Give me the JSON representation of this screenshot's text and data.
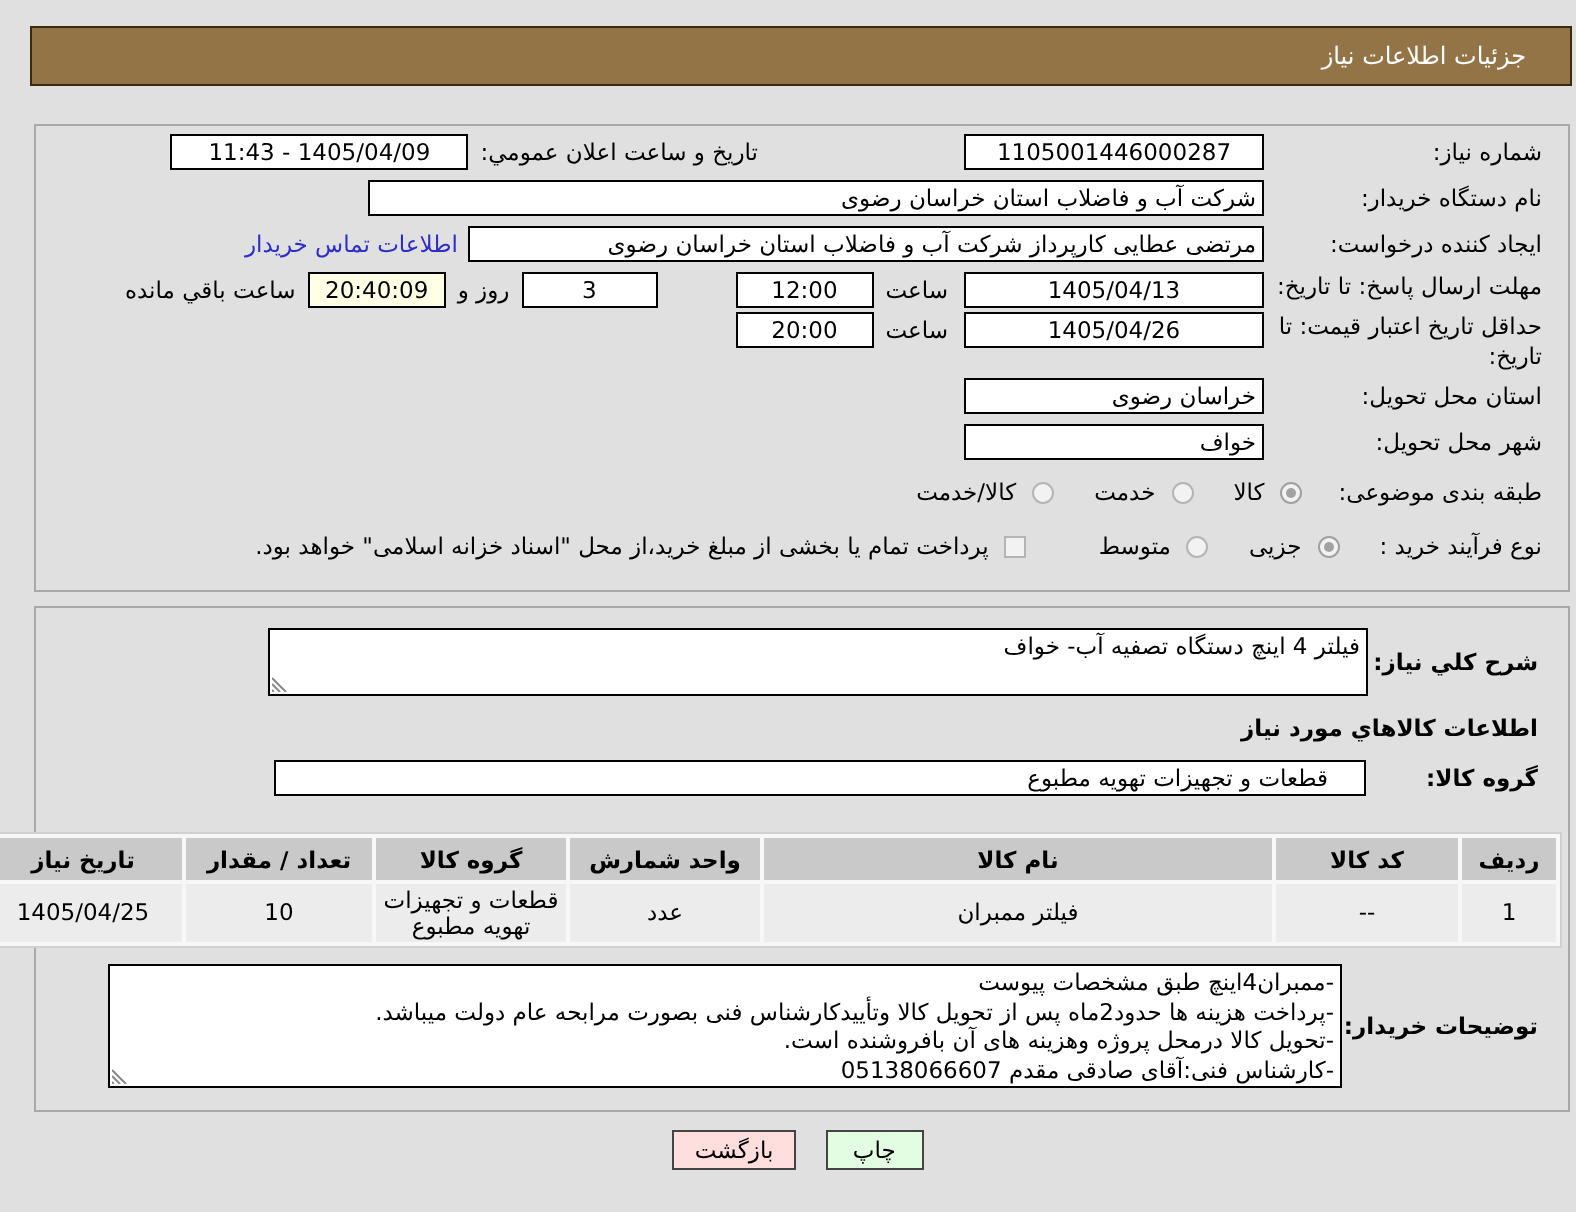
{
  "header": {
    "title": "جزئیات اطلاعات نیاز"
  },
  "details": {
    "need_number": {
      "label": "شماره نیاز:",
      "value": "1105001446000287"
    },
    "announce_datetime": {
      "label": "تاریخ و ساعت اعلان عمومي:",
      "value": "1405/04/09 - 11:43"
    },
    "buyer_org": {
      "label": "نام دستگاه خریدار:",
      "value": "شرکت آب و فاضلاب استان خراسان رضوی"
    },
    "requester": {
      "label": "ایجاد کننده درخواست:",
      "value": "مرتضی عطایی کارپرداز شرکت آب و فاضلاب استان خراسان رضوی",
      "link": "اطلاعات تماس خریدار"
    },
    "response_deadline": {
      "label": "مهلت ارسال پاسخ: تا تاریخ:",
      "date": "1405/04/13",
      "time_label": "ساعت",
      "time": "12:00",
      "days": "3",
      "days_label": "روز و",
      "remaining": "20:40:09",
      "remaining_label": "ساعت باقي مانده"
    },
    "price_validity": {
      "label": "حداقل تاريخ اعتبار قيمت: تا تاریخ:",
      "date": "1405/04/26",
      "time_label": "ساعت",
      "time": "20:00"
    },
    "delivery_province": {
      "label": "استان محل تحویل:",
      "value": "خراسان رضوی"
    },
    "delivery_city": {
      "label": "شهر محل تحویل:",
      "value": "خواف"
    },
    "subject_category": {
      "label": "طبقه بندی موضوعی:",
      "options": [
        {
          "label": "كالا",
          "selected": true
        },
        {
          "label": "خدمت",
          "selected": false
        },
        {
          "label": "كالا/خدمت",
          "selected": false
        }
      ]
    },
    "purchase_process": {
      "label": "نوع فرآیند خرید :",
      "options": [
        {
          "label": "جزیی",
          "selected": true
        },
        {
          "label": "متوسط",
          "selected": false
        }
      ],
      "treasury_option": {
        "label": "پرداخت تمام یا بخشی از مبلغ خرید،از محل \"اسناد خزانه اسلامی\" خواهد بود.",
        "checked": false
      }
    }
  },
  "need": {
    "description_label": "شرح كلي نياز:",
    "description": "فیلتر 4 اینچ دستگاه تصفیه آب- خواف",
    "goods_title": "اطلاعات كالاهاي مورد نياز",
    "goods_group_label": "گروه کالا:",
    "goods_group": "قطعات و تجهیزات تهویه مطبوع",
    "table": {
      "columns": [
        "ردیف",
        "کد کالا",
        "نام کالا",
        "واحد شمارش",
        "گروه کالا",
        "تعداد / مقدار",
        "تاریخ نیاز"
      ],
      "rows": [
        [
          "1",
          "--",
          "فیلتر ممبران",
          "عدد",
          "قطعات و تجهیزات تهویه مطبوع",
          "10",
          "1405/04/25"
        ]
      ]
    },
    "buyer_notes_label": "توضیحات خریدار:",
    "buyer_notes": "-ممبران4اینچ طبق مشخصات پیوست\n-پرداخت هزینه ها حدود2ماه پس از تحویل کالا وتأییدکارشناس فنی بصورت مرابحه عام دولت میباشد.\n-تحویل کالا درمحل پروژه وهزینه های آن بافروشنده است.\n-کارشناس فنی:آقای صادقی مقدم 05138066607"
  },
  "buttons": [
    {
      "label": "چاپ",
      "kind": "print"
    },
    {
      "label": "بازگشت",
      "kind": "back"
    }
  ]
}
